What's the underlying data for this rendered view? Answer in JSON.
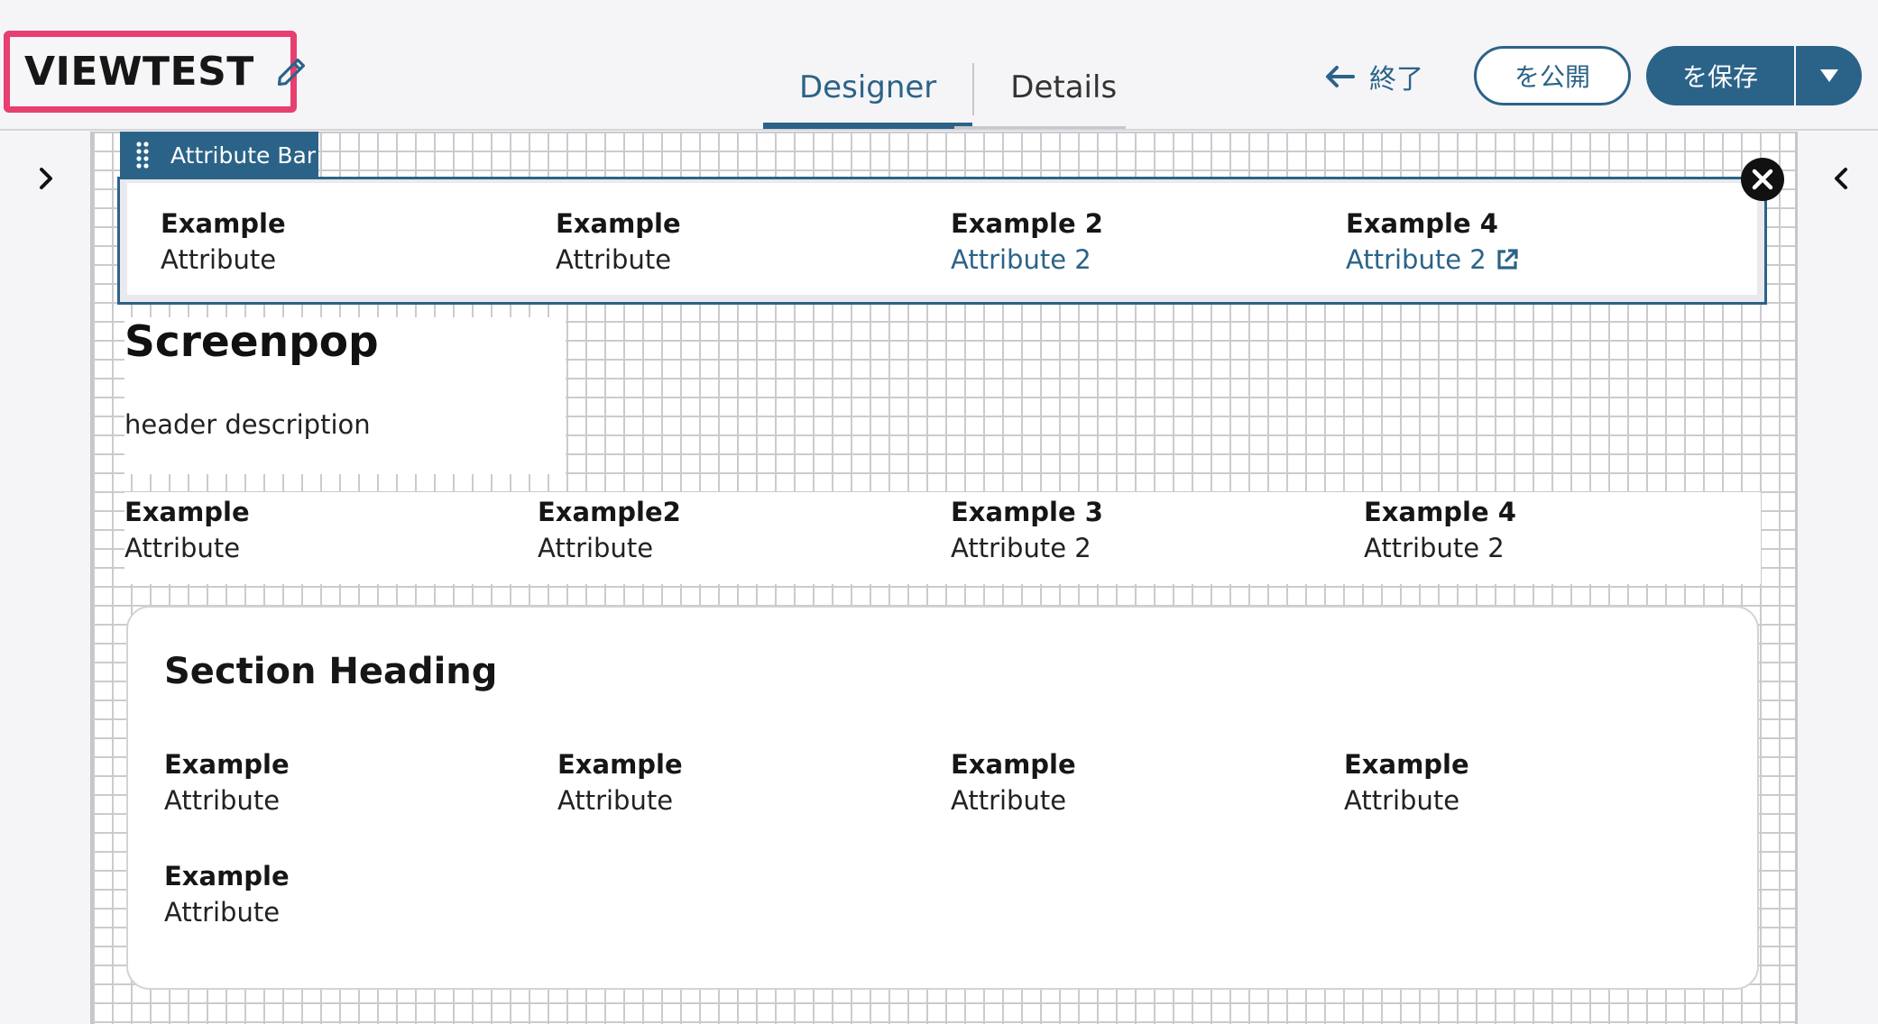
{
  "header": {
    "title": "VIEWTEST",
    "tabs": [
      {
        "label": "Designer",
        "active": true
      },
      {
        "label": "Details",
        "active": false
      }
    ],
    "exit_label": "終了",
    "publish_label": "を公開",
    "save_label": "を保存",
    "accent_color": "#2b6388",
    "title_highlight_color": "#e63f70"
  },
  "attribute_bar": {
    "tag_label": "Attribute Bar",
    "items": [
      {
        "label": "Example",
        "value": "Attribute",
        "link": false
      },
      {
        "label": "Example",
        "value": "Attribute",
        "link": false
      },
      {
        "label": "Example 2",
        "value": "Attribute 2",
        "link": true
      },
      {
        "label": "Example 4",
        "value": "Attribute 2",
        "link": true,
        "external": true
      }
    ]
  },
  "screenpop": {
    "title": "Screenpop",
    "description": "header description"
  },
  "attribute_row": {
    "items": [
      {
        "label": "Example",
        "value": "Attribute"
      },
      {
        "label": "Example2",
        "value": "Attribute"
      },
      {
        "label": "Example 3",
        "value": "Attribute 2"
      },
      {
        "label": "Example 4",
        "value": "Attribute 2"
      }
    ]
  },
  "section": {
    "heading": "Section Heading",
    "items": [
      {
        "label": "Example",
        "value": "Attribute"
      },
      {
        "label": "Example",
        "value": "Attribute"
      },
      {
        "label": "Example",
        "value": "Attribute"
      },
      {
        "label": "Example",
        "value": "Attribute"
      },
      {
        "label": "Example",
        "value": "Attribute"
      }
    ]
  }
}
